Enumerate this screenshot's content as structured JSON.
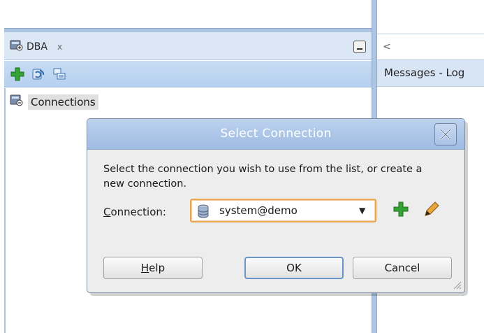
{
  "left_panel": {
    "tab_label": "DBA",
    "tab_close": "x",
    "toolbar_icons": [
      "add-connection-icon",
      "refresh-icon",
      "filter-icon"
    ],
    "tree_items": [
      {
        "label": "Connections",
        "icon": "connections-icon"
      }
    ]
  },
  "right_panel": {
    "scroll_arrow": "<",
    "title": "Messages - Log"
  },
  "dialog": {
    "title": "Select Connection",
    "message": "Select the connection you wish to use from the list, or create a new connection.",
    "connection_label_first": "C",
    "connection_label_rest": "onnection:",
    "connection_value": "system@demo",
    "help_first": "H",
    "help_rest": "elp",
    "ok_label": "OK",
    "cancel_label": "Cancel"
  },
  "colors": {
    "accent_blue": "#adc5e2",
    "titlebar_blue": "#9fbbe2",
    "add_green": "#2e9a2e",
    "select_focus_orange": "#e8a552"
  }
}
